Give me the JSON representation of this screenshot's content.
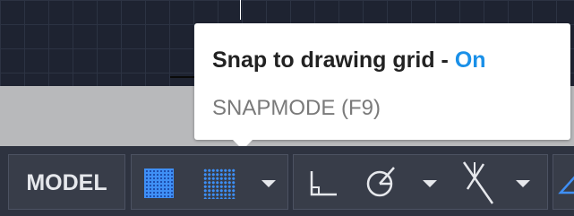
{
  "tooltip": {
    "title": "Snap to drawing grid - ",
    "state": "On",
    "command": "SNAPMODE (F9)"
  },
  "statusbar": {
    "model_label": "MODEL"
  },
  "colors": {
    "accent": "#1a90e8",
    "active_icon": "#3f8ff5",
    "statusbar_bg": "#2e3340"
  },
  "icons": [
    "grid-display-icon",
    "snap-mode-icon",
    "chevron-down-icon",
    "ortho-mode-icon",
    "polar-tracking-icon",
    "isometric-drafting-icon",
    "osnap-icon"
  ]
}
